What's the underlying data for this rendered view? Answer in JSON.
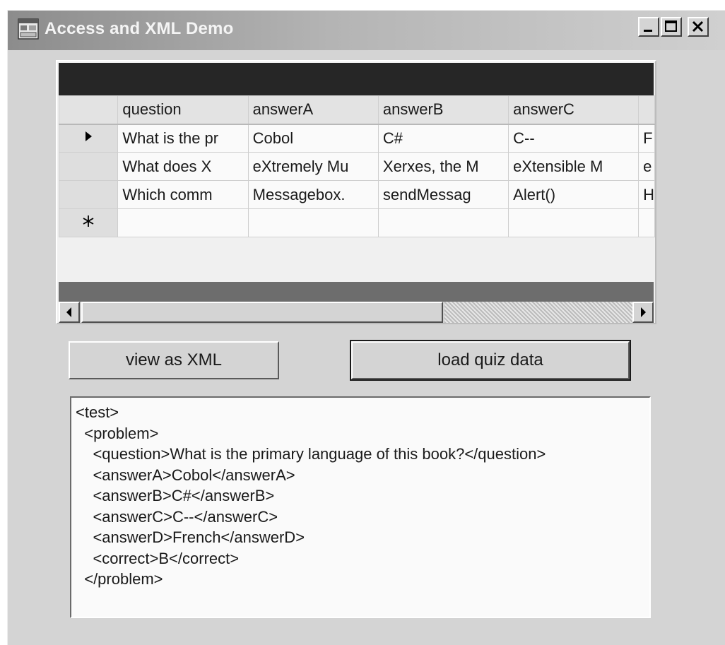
{
  "window": {
    "title": "Access and XML Demo"
  },
  "grid": {
    "columns": [
      "question",
      "answerA",
      "answerB",
      "answerC"
    ],
    "rows": [
      [
        "What is the pr",
        "Cobol",
        "C#",
        "C--",
        "F"
      ],
      [
        "What does X",
        "eXtremely Mu",
        "Xerxes, the M",
        "eXtensible M",
        "e"
      ],
      [
        "Which comm",
        "Messagebox.",
        "sendMessag",
        "Alert()",
        "H"
      ]
    ],
    "current_row_marker": "►",
    "new_row_marker": "✱"
  },
  "buttons": {
    "view_xml": "view as XML",
    "load_quiz": "load quiz data"
  },
  "xml_output": {
    "lines": [
      "<test>",
      "  <problem>",
      "    <question>What is the primary language of this book?</question>",
      "    <answerA>Cobol</answerA>",
      "    <answerB>C#</answerB>",
      "    <answerC>C--</answerC>",
      "    <answerD>French</answerD>",
      "    <correct>B</correct>",
      "  </problem>"
    ]
  }
}
